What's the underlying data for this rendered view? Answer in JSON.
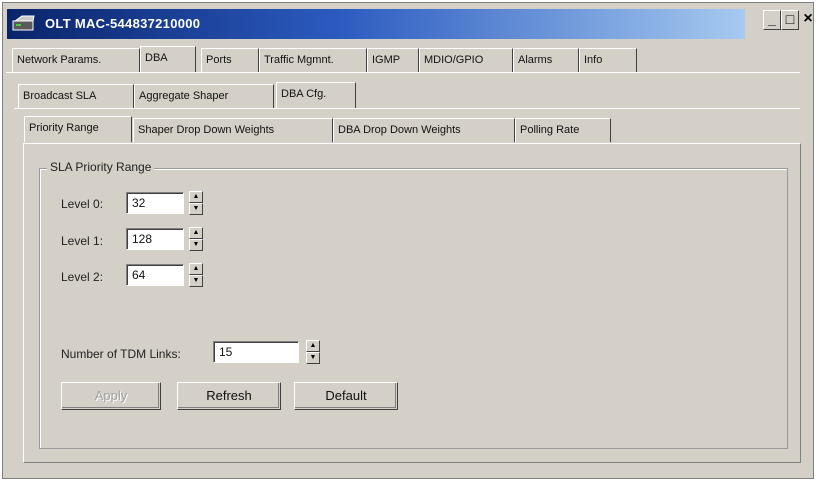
{
  "window": {
    "title": "OLT MAC-544837210000",
    "controls": {
      "minimize": "_",
      "maximize": "□",
      "close": "×"
    }
  },
  "tabs_main": [
    {
      "label": "Network Params.",
      "active": false
    },
    {
      "label": "DBA",
      "active": true
    },
    {
      "label": "Ports",
      "active": false
    },
    {
      "label": "Traffic Mgmnt.",
      "active": false
    },
    {
      "label": "IGMP",
      "active": false
    },
    {
      "label": "MDIO/GPIO",
      "active": false
    },
    {
      "label": "Alarms",
      "active": false
    },
    {
      "label": "Info",
      "active": false
    }
  ],
  "tabs_dba": [
    {
      "label": "Broadcast SLA",
      "active": false
    },
    {
      "label": "Aggregate Shaper",
      "active": false
    },
    {
      "label": "DBA Cfg.",
      "active": true
    }
  ],
  "tabs_cfg": [
    {
      "label": "Priority Range",
      "active": true
    },
    {
      "label": "Shaper Drop Down Weights",
      "active": false
    },
    {
      "label": "DBA Drop Down Weights",
      "active": false
    },
    {
      "label": "Polling Rate",
      "active": false
    }
  ],
  "sla_priority_range": {
    "legend": "SLA Priority Range",
    "levels": [
      {
        "label": "Level 0:",
        "value": "32"
      },
      {
        "label": "Level 1:",
        "value": "128"
      },
      {
        "label": "Level 2:",
        "value": "64"
      }
    ]
  },
  "tdm": {
    "label": "Number of TDM Links:",
    "value": "15"
  },
  "buttons": {
    "apply": "Apply",
    "refresh": "Refresh",
    "default": "Default"
  },
  "icons": {
    "app": "olt-device-icon",
    "spin_up": "▲",
    "spin_down": "▼"
  },
  "colors": {
    "titlebar_start": "#0a246a",
    "titlebar_end": "#a6caf0",
    "face": "#d4d0c8"
  }
}
